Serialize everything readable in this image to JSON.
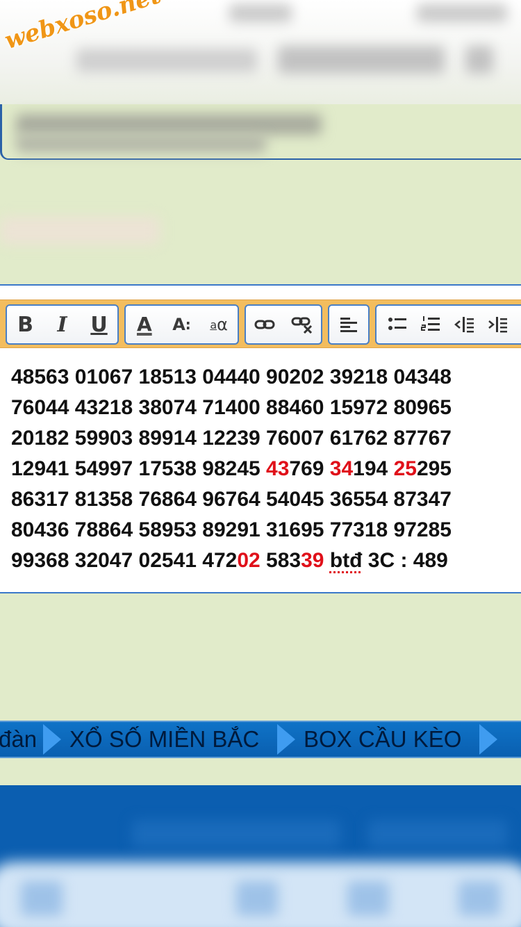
{
  "watermark": "webxoso.net",
  "toolbar": {
    "bold": "B",
    "italic": "I",
    "underline": "U",
    "font_color_label": "A",
    "font_size_label": "A",
    "font_size_mark": ":",
    "case_label_a": "a",
    "case_label_alpha": "α"
  },
  "post_lines": [
    [
      {
        "t": "48563 01067 18513 04440 90202 39218 04348",
        "c": "black"
      }
    ],
    [
      {
        "t": "76044 43218 38074 71400 88460 15972 80965",
        "c": "black"
      }
    ],
    [
      {
        "t": "20182 59903 89914 12239 76007 61762 87767",
        "c": "black"
      }
    ],
    [
      {
        "t": "12941 54997 17538 98245 ",
        "c": "black"
      },
      {
        "t": "43",
        "c": "red"
      },
      {
        "t": "769 ",
        "c": "black"
      },
      {
        "t": "34",
        "c": "red"
      },
      {
        "t": "194 ",
        "c": "black"
      },
      {
        "t": "25",
        "c": "red"
      },
      {
        "t": "295",
        "c": "black"
      }
    ],
    [
      {
        "t": "86317 81358 76864 96764 54045 36554 87347",
        "c": "black"
      }
    ],
    [
      {
        "t": "80436 78864 58953 89291 31695 77318 97285",
        "c": "black"
      }
    ],
    [
      {
        "t": "99368 32047 02541 472",
        "c": "black"
      },
      {
        "t": "02",
        "c": "red"
      },
      {
        "t": " 583",
        "c": "black"
      },
      {
        "t": "39",
        "c": "red"
      },
      {
        "t": " ",
        "c": "black"
      },
      {
        "t": "btđ",
        "c": "spell"
      },
      {
        "t": " 3C : 489",
        "c": "black"
      }
    ]
  ],
  "breadcrumb": {
    "item_0": "đàn",
    "item_1": "XỔ SỐ MIỀN BẮC",
    "item_2": "BOX CẦU KÈO"
  },
  "colors": {
    "background": "#e1ebca",
    "toolbar": "#f3bd5e",
    "nav_bar": "#0b66bd",
    "highlight_red": "#e0101a"
  }
}
